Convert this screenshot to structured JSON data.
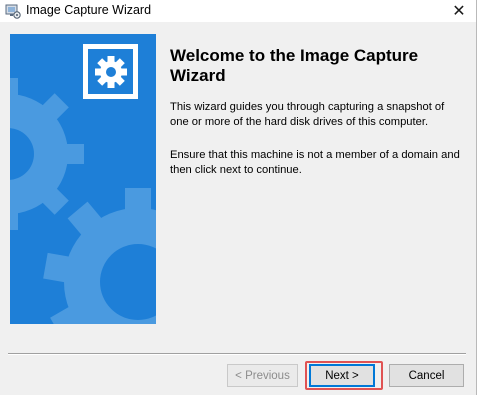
{
  "window": {
    "title": "Image Capture Wizard",
    "close_symbol": "✕"
  },
  "banner": {
    "background_color": "#1e7fd7",
    "logo_icon": "gear-icon"
  },
  "content": {
    "heading": "Welcome to the Image Capture Wizard",
    "paragraph1": "This wizard guides you through capturing a snapshot of one or more of the hard disk drives of this computer.",
    "paragraph2": "Ensure that this machine is not a member of a domain and then click next to continue."
  },
  "buttons": {
    "previous_label": "< Previous",
    "previous_enabled": false,
    "next_label": "Next >",
    "cancel_label": "Cancel"
  },
  "colors": {
    "accent": "#0078d7",
    "highlight": "#e05353"
  }
}
